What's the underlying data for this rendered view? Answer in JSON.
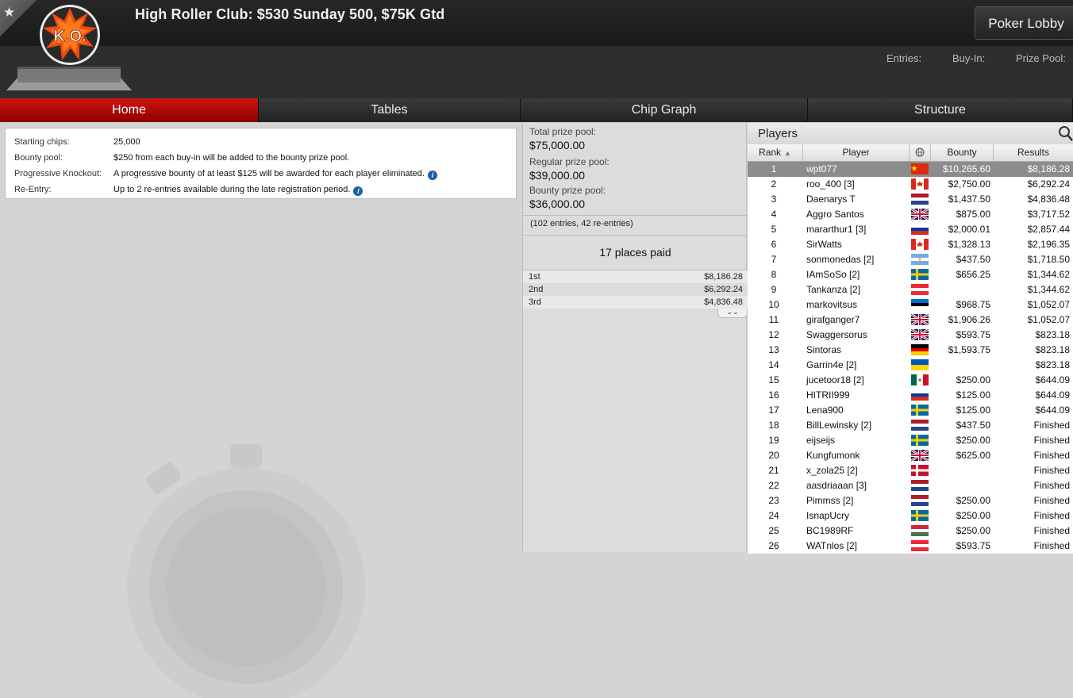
{
  "header": {
    "title": "High Roller Club: $530 Sunday 500, $75K Gtd",
    "logo_text": "K.O.",
    "lobby_button": "Poker Lobby",
    "entries_label": "Entries:",
    "buyin_label": "Buy-In:",
    "prizepool_label": "Prize Pool:"
  },
  "tabs": [
    {
      "label": "Home",
      "active": true
    },
    {
      "label": "Tables"
    },
    {
      "label": "Chip Graph"
    },
    {
      "label": "Structure"
    }
  ],
  "info": {
    "rows": [
      {
        "label": "Starting chips:",
        "value": "25,000"
      },
      {
        "label": "Bounty pool:",
        "value": "$250 from each buy-in will be added to the bounty prize pool."
      },
      {
        "label": "Progressive Knockout:",
        "value": "A progressive bounty of at least $125 will be awarded for each player eliminated."
      },
      {
        "label": "Re-Entry:",
        "value": "Up to 2 re-entries available during the late registration period."
      }
    ]
  },
  "prize": {
    "total_label": "Total prize pool:",
    "total_value": "$75,000.00",
    "regular_label": "Regular prize pool:",
    "regular_value": "$39,000.00",
    "bounty_label": "Bounty prize pool:",
    "bounty_value": "$36,000.00",
    "entries": "(102 entries, 42 re-entries)",
    "places_paid": "17 places paid",
    "payouts": [
      {
        "place": "1st",
        "amount": "$8,186.28"
      },
      {
        "place": "2nd",
        "amount": "$6,292.24"
      },
      {
        "place": "3rd",
        "amount": "$4,836.48"
      }
    ]
  },
  "players": {
    "title": "Players",
    "columns": {
      "rank": "Rank",
      "player": "Player",
      "bounty": "Bounty",
      "results": "Results"
    },
    "rows": [
      {
        "rank": "1",
        "name": "wpt077",
        "flag": "china",
        "bounty": "$10,265.60",
        "result": "$8,186.28",
        "selected": true
      },
      {
        "rank": "2",
        "name": "roo_400 [3]",
        "flag": "canada",
        "bounty": "$2,750.00",
        "result": "$6,292.24"
      },
      {
        "rank": "3",
        "name": "Daenarys T",
        "flag": "netherlands",
        "bounty": "$1,437.50",
        "result": "$4,836.48"
      },
      {
        "rank": "4",
        "name": "Aggro Santos",
        "flag": "uk",
        "bounty": "$875.00",
        "result": "$3,717.52"
      },
      {
        "rank": "5",
        "name": "mararthur1 [3]",
        "flag": "russia",
        "bounty": "$2,000.01",
        "result": "$2,857.44"
      },
      {
        "rank": "6",
        "name": "SirWatts",
        "flag": "canada",
        "bounty": "$1,328.13",
        "result": "$2,196.35"
      },
      {
        "rank": "7",
        "name": "sonmonedas [2]",
        "flag": "argentina",
        "bounty": "$437.50",
        "result": "$1,718.50"
      },
      {
        "rank": "8",
        "name": "IAmSoSo [2]",
        "flag": "sweden",
        "bounty": "$656.25",
        "result": "$1,344.62"
      },
      {
        "rank": "9",
        "name": "Tankanza [2]",
        "flag": "austria",
        "bounty": "",
        "result": "$1,344.62"
      },
      {
        "rank": "10",
        "name": "markovitsus",
        "flag": "estonia",
        "bounty": "$968.75",
        "result": "$1,052.07"
      },
      {
        "rank": "11",
        "name": "girafganger7",
        "flag": "uk",
        "bounty": "$1,906.26",
        "result": "$1,052.07"
      },
      {
        "rank": "12",
        "name": "Swaggersorus",
        "flag": "uk",
        "bounty": "$593.75",
        "result": "$823.18"
      },
      {
        "rank": "13",
        "name": "Sintoras",
        "flag": "germany",
        "bounty": "$1,593.75",
        "result": "$823.18"
      },
      {
        "rank": "14",
        "name": "Garrin4e [2]",
        "flag": "ukraine",
        "bounty": "",
        "result": "$823.18"
      },
      {
        "rank": "15",
        "name": "jucetoor18 [2]",
        "flag": "mexico",
        "bounty": "$250.00",
        "result": "$644.09"
      },
      {
        "rank": "16",
        "name": "HITRII999",
        "flag": "russia",
        "bounty": "$125.00",
        "result": "$644.09"
      },
      {
        "rank": "17",
        "name": "Lena900",
        "flag": "sweden",
        "bounty": "$125.00",
        "result": "$644.09"
      },
      {
        "rank": "18",
        "name": "BillLewinsky [2]",
        "flag": "netherlands",
        "bounty": "$437.50",
        "result": "Finished"
      },
      {
        "rank": "19",
        "name": "eijseijs",
        "flag": "sweden",
        "bounty": "$250.00",
        "result": "Finished"
      },
      {
        "rank": "20",
        "name": "Kungfumonk",
        "flag": "uk",
        "bounty": "$625.00",
        "result": "Finished"
      },
      {
        "rank": "21",
        "name": "x_zola25 [2]",
        "flag": "denmark",
        "bounty": "",
        "result": "Finished"
      },
      {
        "rank": "22",
        "name": "aasdriaaan [3]",
        "flag": "netherlands",
        "bounty": "",
        "result": "Finished"
      },
      {
        "rank": "23",
        "name": "Pimmss [2]",
        "flag": "netherlands",
        "bounty": "$250.00",
        "result": "Finished"
      },
      {
        "rank": "24",
        "name": "IsnapUcry",
        "flag": "sweden",
        "bounty": "$250.00",
        "result": "Finished"
      },
      {
        "rank": "25",
        "name": "BC1989RF",
        "flag": "hungary",
        "bounty": "$250.00",
        "result": "Finished"
      },
      {
        "rank": "26",
        "name": "WATnlos [2]",
        "flag": "austria",
        "bounty": "$593.75",
        "result": "Finished"
      }
    ]
  },
  "colors": {
    "accent_red": "#c40d0d",
    "selected_row": "#8c8c8c"
  }
}
